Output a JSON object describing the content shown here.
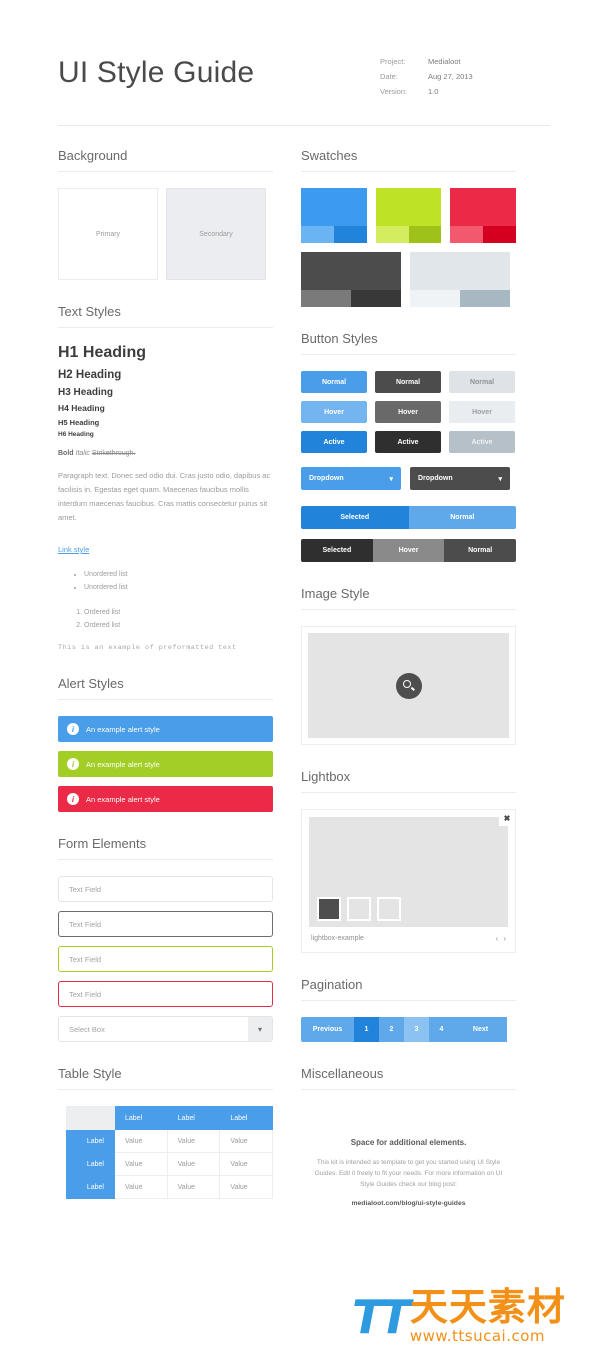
{
  "header": {
    "title": "UI Style Guide",
    "meta": [
      {
        "key": "Project:",
        "value": "Medialoot"
      },
      {
        "key": "Date:",
        "value": "Aug 27, 2013"
      },
      {
        "key": "Version:",
        "value": "1.0"
      }
    ]
  },
  "background": {
    "title": "Background",
    "primary_label": "Primary",
    "secondary_label": "Secondary",
    "primary_color": "#ffffff",
    "secondary_color": "#ebedf0"
  },
  "text_styles": {
    "title": "Text Styles",
    "h1": "H1 Heading",
    "h2": "H2 Heading",
    "h3": "H3 Heading",
    "h4": "H4 Heading",
    "h5": "H5 Heading",
    "h6": "H6 Heading",
    "bold": "Bold",
    "italic": "Italic",
    "strikethrough": "Strikethrough.",
    "paragraph": "Paragraph text. Donec sed odio dui. Cras justo odio, dapibus ac facilisis in. Egestas eget quam. Maecenas faucibus mollis interdum maecenas faucibus. Cras mattis consectetur purus sit amet.",
    "link": "Link style",
    "unordered": [
      "Unordered list",
      "Unordered list"
    ],
    "ordered": [
      "Ordered list",
      "Ordered list"
    ],
    "preformatted": "This is an example of preformatted text",
    "link_color": "#4a9de8"
  },
  "alerts": {
    "title": "Alert Styles",
    "icon": "i",
    "items": [
      {
        "label": "An example alert style",
        "color": "#4a9de8"
      },
      {
        "label": "An example alert style",
        "color": "#a2ce26"
      },
      {
        "label": "An example alert style",
        "color": "#ea2a46"
      }
    ]
  },
  "forms": {
    "title": "Form Elements",
    "fields": [
      {
        "placeholder": "Text Field",
        "state": "default"
      },
      {
        "placeholder": "Text Field",
        "state": "focus"
      },
      {
        "placeholder": "Text Field",
        "state": "success"
      },
      {
        "placeholder": "Text Field",
        "state": "error"
      }
    ],
    "select_label": "Select Box"
  },
  "table": {
    "title": "Table Style",
    "corner": "",
    "column_headers": [
      "Label",
      "Label",
      "Label"
    ],
    "rows": [
      {
        "header": "Label",
        "values": [
          "Value",
          "Value",
          "Value"
        ]
      },
      {
        "header": "Label",
        "values": [
          "Value",
          "Value",
          "Value"
        ]
      },
      {
        "header": "Label",
        "values": [
          "Value",
          "Value",
          "Value"
        ]
      }
    ],
    "header_color": "#4a9de8"
  },
  "swatches": {
    "title": "Swatches",
    "items": [
      {
        "main": "#3d9bef",
        "light": "#6bb4f3",
        "dark": "#2183da"
      },
      {
        "main": "#bde226",
        "light": "#d3ed5e",
        "dark": "#9fc21b"
      },
      {
        "main": "#ea2a46",
        "light": "#f2596f",
        "dark": "#d4001f"
      },
      {
        "main": "#4c4c4c",
        "light": "#7a7a7a",
        "dark": "#383838"
      },
      {
        "main": "#e1e6ea",
        "light": "#f0f3f5",
        "dark": "#a8b8c2"
      }
    ]
  },
  "buttons": {
    "title": "Button Styles",
    "rows": [
      {
        "label": "Normal",
        "blue": "#4a9de8",
        "dark": "#4c4c4c",
        "gray": "#dfe3e8"
      },
      {
        "label": "Hover",
        "blue": "#74b5ef",
        "dark": "#696969",
        "gray": "#eaedf0"
      },
      {
        "label": "Active",
        "blue": "#2183da",
        "dark": "#2f2f2f",
        "gray": "#b6c0c9"
      }
    ],
    "labels": [
      "Normal",
      "Hover",
      "Active"
    ]
  },
  "dropdowns": [
    {
      "label": "Dropdown",
      "color": "#4a9de8"
    },
    {
      "label": "Dropdown",
      "color": "#4c4c4c"
    }
  ],
  "tabbars": {
    "blue": [
      {
        "label": "Selected",
        "state": "selected"
      },
      {
        "label": "Normal",
        "state": "normal"
      }
    ],
    "dark": [
      {
        "label": "Selected",
        "state": "selected"
      },
      {
        "label": "Hover",
        "state": "hover"
      },
      {
        "label": "Normal",
        "state": "normal"
      }
    ]
  },
  "image_style": {
    "title": "Image Style",
    "zoom_icon": "search-icon"
  },
  "lightbox": {
    "title": "Lightbox",
    "close": "✖",
    "caption": "lightbox-example",
    "prev": "‹",
    "next": "›",
    "thumbs": [
      "active",
      "inactive",
      "inactive"
    ]
  },
  "pagination": {
    "title": "Pagination",
    "previous": "Previous",
    "next": "Next",
    "pages": [
      {
        "label": "1",
        "state": "active"
      },
      {
        "label": "2",
        "state": "normal"
      },
      {
        "label": "3",
        "state": "hover"
      },
      {
        "label": "4",
        "state": "normal"
      }
    ]
  },
  "misc": {
    "title": "Miscellaneous",
    "heading": "Space for additional elements.",
    "body": "This kit is intended as template to get you started using UI Style Guides. Edit it freely to fit your needs. For more information on UI Style Guides check our blog post:",
    "link": "medialoot.com/blog/ui-style-guides"
  },
  "watermark": {
    "logo": "TT",
    "chinese": "天天素材",
    "url": "www.ttsucai.com"
  }
}
